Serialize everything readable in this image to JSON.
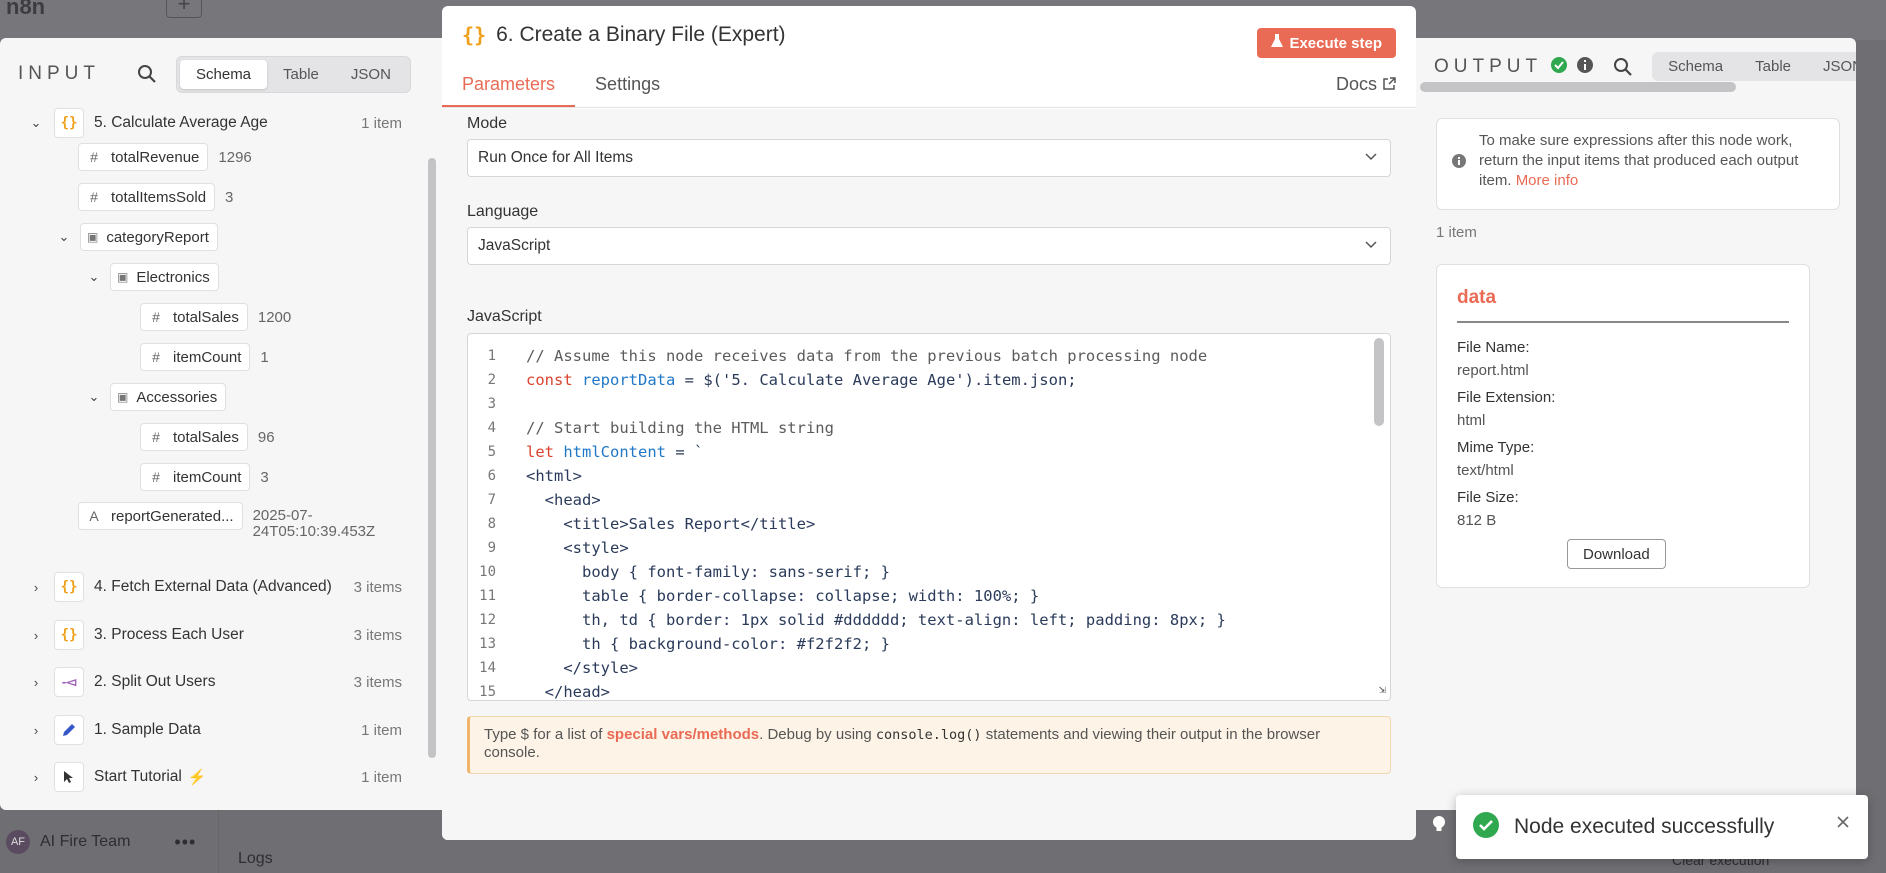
{
  "background": {
    "logo_text": "n8n",
    "plus_label": "+",
    "team_name": "AI Fire Team",
    "avatar_initials": "AF",
    "more_label": "•••",
    "logs_label": "Logs",
    "clear_label": "Clear execution"
  },
  "input_panel": {
    "title": "INPUT",
    "view_tabs": [
      "Schema",
      "Table",
      "JSON"
    ],
    "active_view": "Schema",
    "node5": {
      "name": "5. Calculate Average Age",
      "count": "1 item"
    },
    "fields": {
      "totalRevenue": {
        "name": "totalRevenue",
        "value": "1296"
      },
      "totalItemsSold": {
        "name": "totalItemsSold",
        "value": "3"
      },
      "categoryReport": {
        "name": "categoryReport"
      },
      "electronics": {
        "name": "Electronics"
      },
      "el_totalSales": {
        "name": "totalSales",
        "value": "1200"
      },
      "el_itemCount": {
        "name": "itemCount",
        "value": "1"
      },
      "accessories": {
        "name": "Accessories"
      },
      "ac_totalSales": {
        "name": "totalSales",
        "value": "96"
      },
      "ac_itemCount": {
        "name": "itemCount",
        "value": "3"
      },
      "reportGenerated": {
        "name": "reportGenerated...",
        "value_line1": "2025-07-",
        "value_line2": "24T05:10:39.453Z"
      }
    },
    "other_nodes": [
      {
        "name": "4. Fetch External Data (Advanced)",
        "count": "3 items"
      },
      {
        "name": "3. Process Each User",
        "count": "3 items"
      },
      {
        "name": "2. Split Out Users",
        "count": "3 items"
      },
      {
        "name": "1. Sample Data",
        "count": "1 item"
      },
      {
        "name": "Start Tutorial",
        "count": "1 item"
      }
    ]
  },
  "modal": {
    "title": "6. Create a Binary File (Expert)",
    "execute_label": "Execute step",
    "tabs": [
      "Parameters",
      "Settings"
    ],
    "active_tab": "Parameters",
    "docs_label": "Docs",
    "mode_label": "Mode",
    "mode_value": "Run Once for All Items",
    "language_label": "Language",
    "language_value": "JavaScript",
    "code_label": "JavaScript",
    "code_line_numbers": [
      "1",
      "2",
      "3",
      "4",
      "5",
      "6",
      "7",
      "8",
      "9",
      "10",
      "11",
      "12",
      "13",
      "14",
      "15"
    ],
    "code": {
      "l1": "// Assume this node receives data from the previous batch processing node",
      "l2_kw": "const",
      "l2_var": "reportData",
      "l2_rest": " = $('5. Calculate Average Age').item.json;",
      "l4": "// Start building the HTML string",
      "l5_kw": "let",
      "l5_var": "htmlContent",
      "l5_rest": " = `",
      "l6": "<html>",
      "l7": "  <head>",
      "l8": "    <title>Sales Report</title>",
      "l9": "    <style>",
      "l10": "      body { font-family: sans-serif; }",
      "l11": "      table { border-collapse: collapse; width: 100%; }",
      "l12": "      th, td { border: 1px solid #dddddd; text-align: left; padding: 8px; }",
      "l13": "      th { background-color: #f2f2f2; }",
      "l14": "    </style>",
      "l15": "  </head>"
    },
    "hint_pre": "Type $ for a list of ",
    "hint_link": "special vars/methods",
    "hint_mid": ". Debug by using ",
    "hint_code": "console.log()",
    "hint_post": " statements and viewing their output in the browser console."
  },
  "output_panel": {
    "title": "OUTPUT",
    "view_tabs": [
      "Schema",
      "Table",
      "JSON"
    ],
    "notice_text": "To make sure expressions after this node work, return the input items that produced each output item.",
    "notice_link": "More info",
    "items_count": "1 item",
    "card_title": "data",
    "file": [
      {
        "key": "File Name:",
        "value": "report.html"
      },
      {
        "key": "File Extension:",
        "value": "html"
      },
      {
        "key": "Mime Type:",
        "value": "text/html"
      },
      {
        "key": "File Size:",
        "value": "812 B"
      }
    ],
    "download_label": "Download"
  },
  "toast": {
    "message": "Node executed successfully"
  },
  "colors": {
    "accent": "#ea6b55",
    "success": "#2fa84f",
    "curly": "#f0a11c"
  }
}
